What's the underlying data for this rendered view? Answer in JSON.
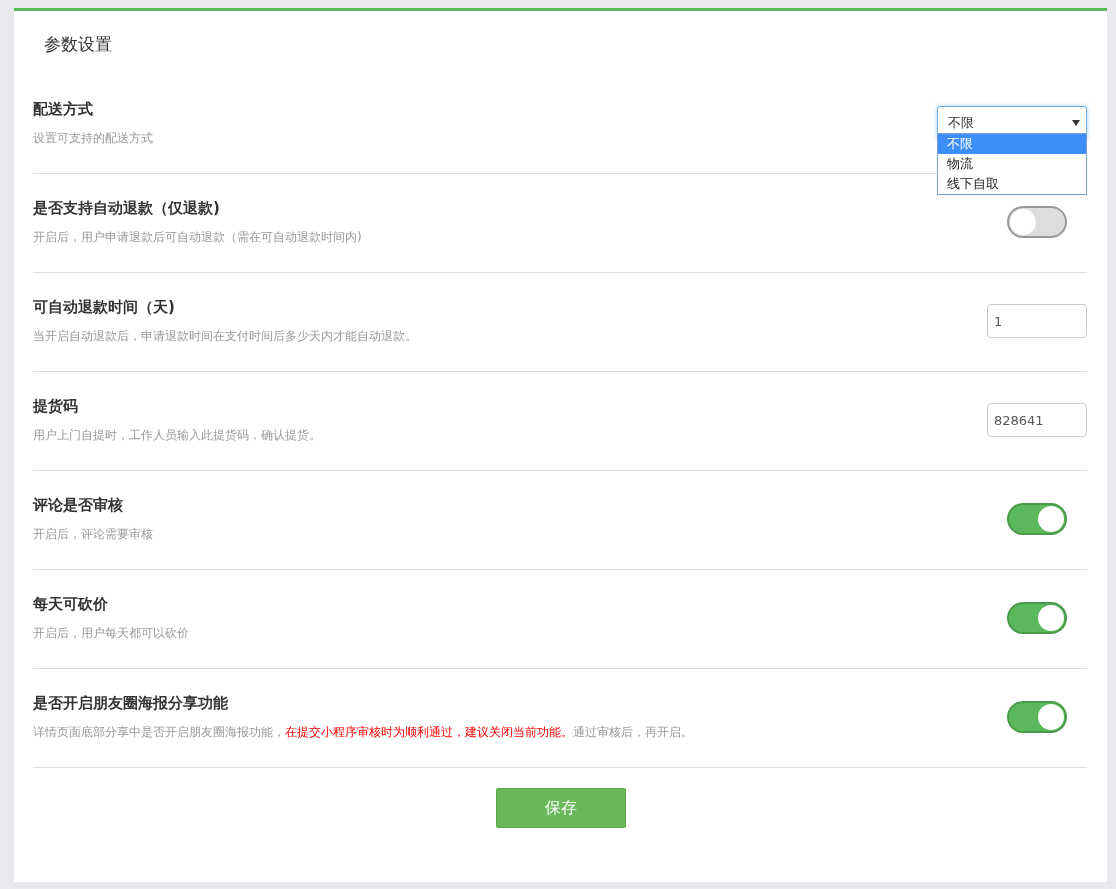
{
  "panel": {
    "title": "参数设置"
  },
  "settings": [
    {
      "kind": "select",
      "title": "配送方式",
      "description": [
        {
          "kind": "plain",
          "text": "设置可支持的配送方式"
        }
      ],
      "value": "不限",
      "options": [
        {
          "label": "不限",
          "selected": true
        },
        {
          "label": "物流",
          "selected": false
        },
        {
          "label": "线下自取",
          "selected": false
        }
      ]
    },
    {
      "kind": "toggle",
      "title": "是否支持自动退款（仅退款)",
      "description": [
        {
          "kind": "plain",
          "text": "开启后，用户申请退款后可自动退款（需在可自动退款时间内)"
        }
      ],
      "on": false
    },
    {
      "kind": "input",
      "title": "可自动退款时间（天)",
      "description": [
        {
          "kind": "plain",
          "text": "当开启自动退款后，申请退款时间在支付时间后多少天内才能自动退款。"
        }
      ],
      "value": "1"
    },
    {
      "kind": "input",
      "title": "提货码",
      "description": [
        {
          "kind": "plain",
          "text": "用户上门自提时，工作人员输入此提货码，确认提货。"
        }
      ],
      "value": "828641"
    },
    {
      "kind": "toggle",
      "title": "评论是否审核",
      "description": [
        {
          "kind": "plain",
          "text": "开启后，评论需要审核"
        }
      ],
      "on": true
    },
    {
      "kind": "toggle",
      "title": "每天可砍价",
      "description": [
        {
          "kind": "plain",
          "text": "开启后，用户每天都可以砍价"
        }
      ],
      "on": true
    },
    {
      "kind": "toggle",
      "title": "是否开启朋友圈海报分享功能",
      "description": [
        {
          "kind": "plain",
          "text": "详情页面底部分享中是否开启朋友圈海报功能，"
        },
        {
          "kind": "warning",
          "text": "在提交小程序审核时为顺利通过，建议关闭当前功能。"
        },
        {
          "kind": "plain",
          "text": "通过审核后，再开启。"
        }
      ],
      "on": true
    }
  ],
  "save_button": "保存"
}
